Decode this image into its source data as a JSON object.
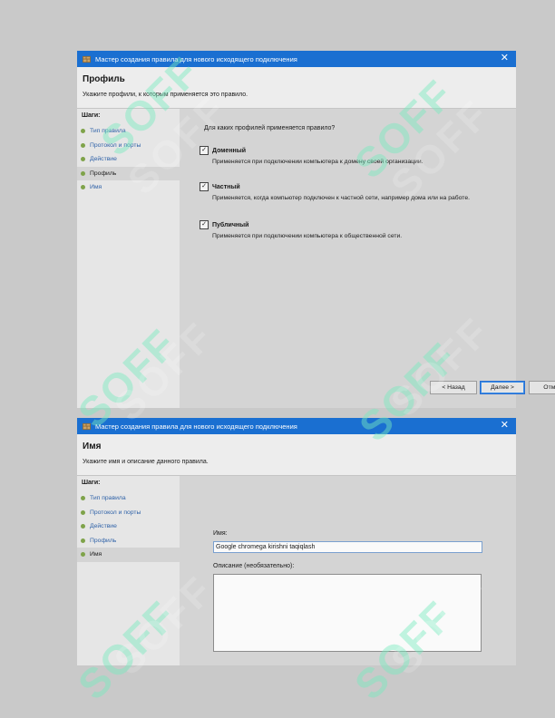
{
  "window1": {
    "title": "Мастер создания правила для нового исходящего подключения",
    "close": "✕",
    "page_title": "Профиль",
    "page_desc": "Укажите профили, к которым применяется это правило.",
    "steps_label": "Шаги:",
    "steps": [
      "Тип правила",
      "Протокол и порты",
      "Действие",
      "Профиль",
      "Имя"
    ],
    "active_step": "Профиль",
    "question": "Для каких профилей применяется правило?",
    "options": [
      {
        "label": "Доменный",
        "checked": true,
        "desc": "Применяется при подключении компьютера к домену своей организации."
      },
      {
        "label": "Частный",
        "checked": true,
        "desc": "Применяется, когда компьютер подключен к частной сети, например дома или на работе."
      },
      {
        "label": "Публичный",
        "checked": true,
        "desc": "Применяется при подключении компьютера к общественной сети."
      }
    ],
    "check_mark": "✓",
    "buttons": {
      "back": "< Назад",
      "next": "Далее >",
      "cancel": "Отмена"
    }
  },
  "window2": {
    "title": "Мастер создания правила для нового исходящего подключения",
    "close": "✕",
    "page_title": "Имя",
    "page_desc": "Укажите имя и описание данного правила.",
    "steps_label": "Шаги:",
    "steps": [
      "Тип правила",
      "Протокол и порты",
      "Действие",
      "Профиль",
      "Имя"
    ],
    "active_step": "Имя",
    "name_label": "Имя:",
    "name_value": "Google chromega kirishni taqiqlash",
    "desc_label": "Описание (необязательно):",
    "desc_value": ""
  },
  "watermark": "SOFF",
  "colors": {
    "titlebar": "#1a6fd1",
    "step_link": "#2f62a8",
    "step_dot": "#7fa34a",
    "watermark": "#78ecbe"
  }
}
